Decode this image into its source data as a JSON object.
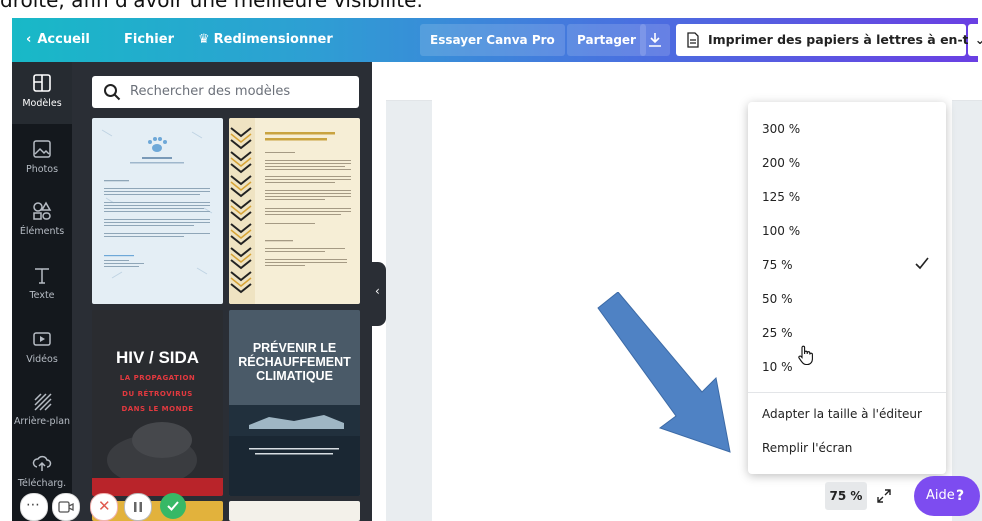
{
  "caption": "droite, afin d'avoir une meilleure visibilité.",
  "topbar": {
    "home": "Accueil",
    "file": "Fichier",
    "resize": "Redimensionner",
    "try_pro": "Essayer Canva Pro",
    "share": "Partager",
    "doc_title": "Imprimer des papiers à lettres à en-tête"
  },
  "sidebar": {
    "items": [
      {
        "label": "Modèles",
        "icon": "templates-icon"
      },
      {
        "label": "Photos",
        "icon": "photo-icon"
      },
      {
        "label": "Éléments",
        "icon": "elements-icon"
      },
      {
        "label": "Texte",
        "icon": "text-icon"
      },
      {
        "label": "Vidéos",
        "icon": "video-icon"
      },
      {
        "label": "Arrière-plan",
        "icon": "background-icon"
      },
      {
        "label": "Télécharg.",
        "icon": "upload-icon"
      }
    ]
  },
  "search": {
    "placeholder": "Rechercher des modèles"
  },
  "templates": {
    "t3": {
      "title": "HIV / SIDA",
      "sub1": "LA PROPAGATION",
      "sub2": "DU RÉTROVIRUS",
      "sub3": "DANS LE MONDE"
    },
    "t4": {
      "title1": "PRÉVENIR LE",
      "title2": "RÉCHAUFFEMENT",
      "title3": "CLIMATIQUE"
    }
  },
  "zoom_menu": {
    "options": [
      "300 %",
      "200 %",
      "125 %",
      "100 %",
      "75 %",
      "50 %",
      "25 %",
      "10 %"
    ],
    "selected": "75 %",
    "fit": "Adapter la taille à l'éditeur",
    "fill": "Remplir l'écran"
  },
  "zoom_value": "75 %",
  "help_label": "Aide",
  "help_symbol": "?",
  "colors": {
    "accent": "#7d4cf0",
    "arrow": "#4f82c4"
  }
}
